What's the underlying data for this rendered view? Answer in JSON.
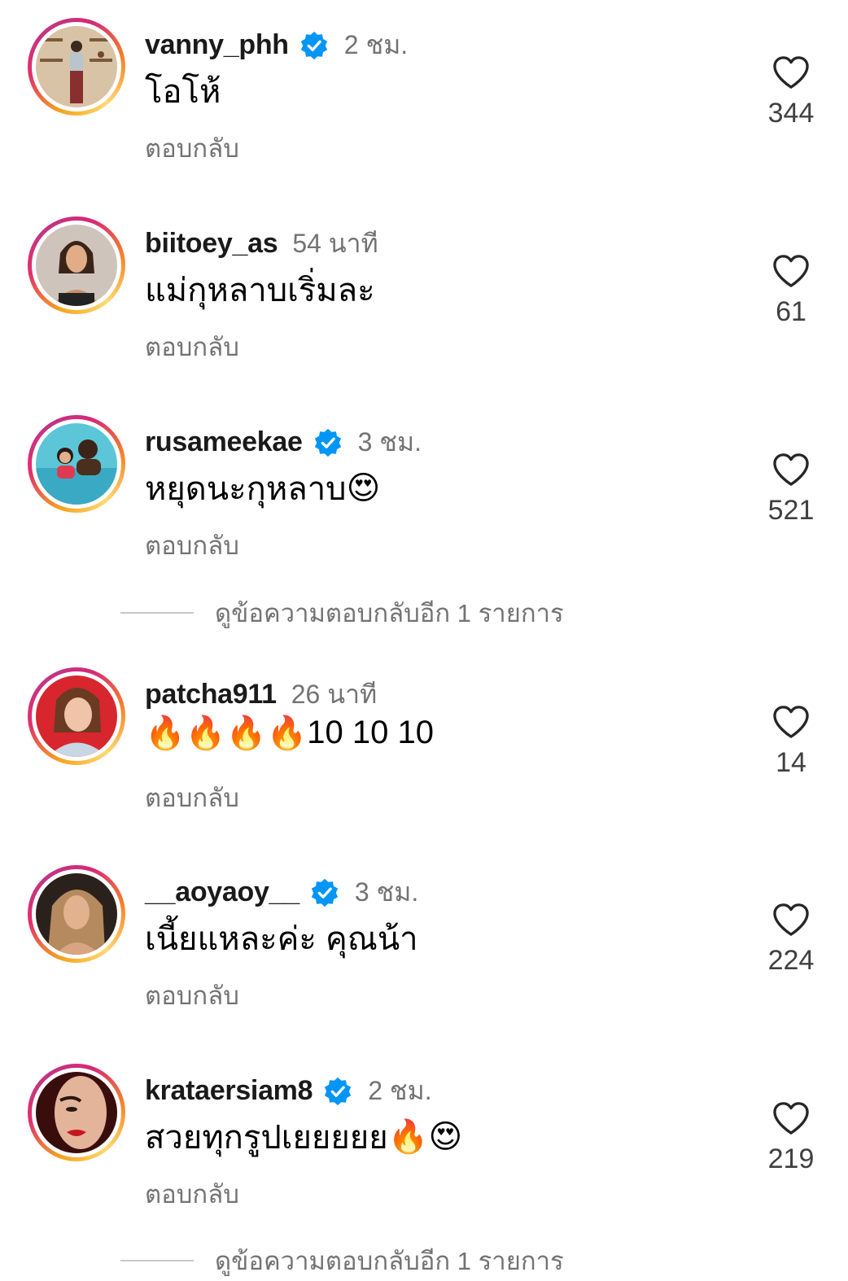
{
  "comments": [
    {
      "username": "vanny_phh",
      "verified": true,
      "time": "2 ชม.",
      "text": "โอโห้",
      "emojis": [],
      "reply_label": "ตอบกลับ",
      "likes": "344",
      "avatar": "woman-in-room-avatar"
    },
    {
      "username": "biitoey_as",
      "verified": false,
      "time": "54 นาที",
      "text": "แม่กุหลาบเริ่มละ",
      "emojis": [],
      "reply_label": "ตอบกลับ",
      "likes": "61",
      "avatar": "woman-portrait-avatar"
    },
    {
      "username": "rusameekae",
      "verified": true,
      "time": "3 ชม.",
      "text": "หยุดนะกุหลาบ",
      "emojis": [
        "😍"
      ],
      "reply_label": "ตอบกลับ",
      "likes": "521",
      "avatar": "pool-family-avatar"
    },
    {
      "username": "patcha911",
      "verified": false,
      "time": "26 นาที",
      "text": "10 10 10",
      "emojis_before": [
        "🔥",
        "🔥",
        "🔥",
        "🔥"
      ],
      "reply_label": "ตอบกลับ",
      "likes": "14",
      "avatar": "woman-red-background-avatar"
    },
    {
      "username": "__aoyaoy__",
      "verified": true,
      "time": "3 ชม.",
      "text": "เนี้ยแหละค่ะ คุณน้า",
      "emojis": [],
      "reply_label": "ตอบกลับ",
      "likes": "224",
      "avatar": "woman-blonde-avatar"
    },
    {
      "username": "krataersiam8",
      "verified": true,
      "time": "2 ชม.",
      "text": "สวยทุกรูปเยยยยย",
      "emojis": [
        "🔥",
        "😍"
      ],
      "reply_label": "ตอบกลับ",
      "likes": "219",
      "avatar": "woman-red-lips-avatar"
    }
  ],
  "more_replies": [
    {
      "label": "ดูข้อความตอบกลับอีก 1 รายการ"
    },
    {
      "label": "ดูข้อความตอบกลับอีก 1 รายการ"
    }
  ],
  "colors": {
    "verified_blue": "#0095f6",
    "secondary_text": "#737373",
    "heart_stroke": "#262626"
  },
  "icons": {
    "like": "heart-outline-icon",
    "verified": "verified-badge-icon"
  }
}
